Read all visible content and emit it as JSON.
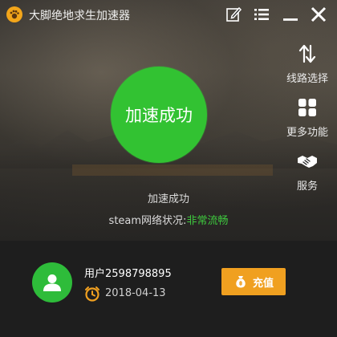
{
  "app": {
    "title": "大脚绝地求生加速器"
  },
  "main": {
    "button_label": "加速成功",
    "status_text": "加速成功",
    "network_prefix": "steam网络状况:",
    "network_status": "非常流畅"
  },
  "sidebar": {
    "items": [
      {
        "label": "线路选择",
        "icon": "route-switch-icon"
      },
      {
        "label": "更多功能",
        "icon": "grid-icon"
      },
      {
        "label": "服务",
        "icon": "handshake-icon"
      }
    ]
  },
  "account": {
    "username": "用户2598798895",
    "date": "2018-04-13",
    "recharge_label": "充值"
  },
  "colors": {
    "accent_green": "#32c232",
    "status_green": "#3ec73e",
    "recharge_orange": "#f0a020",
    "bottom_bg": "#1e1e1e"
  }
}
